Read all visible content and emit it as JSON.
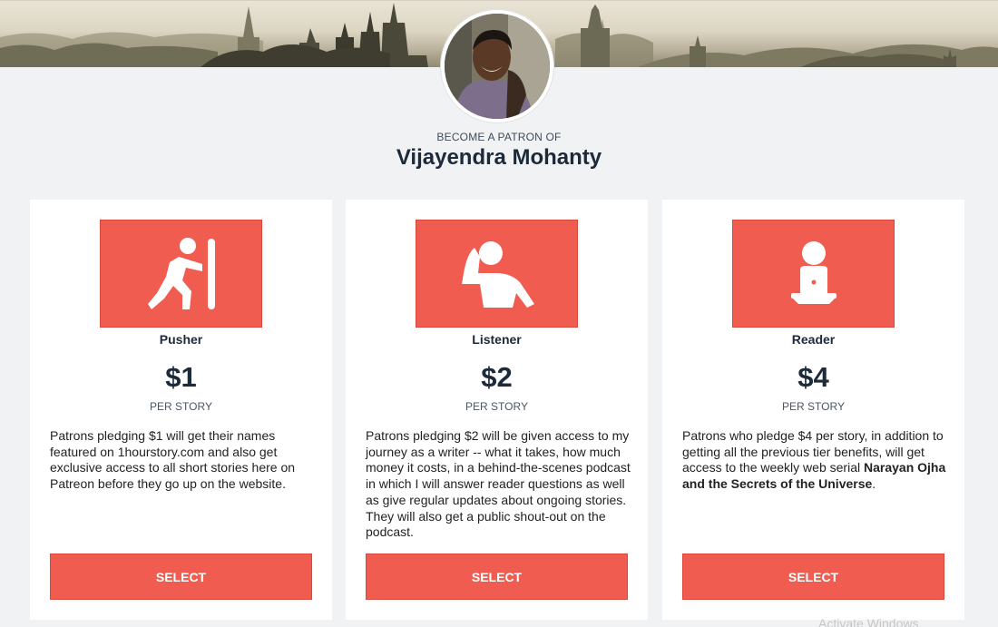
{
  "header": {
    "eyebrow": "BECOME A PATRON OF",
    "creator_name": "Vijayendra Mohanty"
  },
  "tiers": [
    {
      "name": "Pusher",
      "icon": "pushing-figure-icon",
      "price": "$1",
      "per": "PER STORY",
      "description": "Patrons pledging $1 will get their names featured on 1hourstory.com and also get exclusive access to all short stories here on Patreon before they go up on the website.",
      "button": "SELECT"
    },
    {
      "name": "Listener",
      "icon": "listening-figure-icon",
      "price": "$2",
      "per": "PER STORY",
      "description": "Patrons pledging $2 will be given access to my journey as a writer -- what it takes, how much money it costs, in a behind-the-scenes podcast in which I will answer reader questions as well as give regular updates about ongoing stories. They will also get a public shout-out on the podcast.",
      "button": "SELECT"
    },
    {
      "name": "Reader",
      "icon": "reader-laptop-icon",
      "price": "$4",
      "per": "PER STORY",
      "description_before": "Patrons who pledge $4 per story, in addition to getting all the previous tier benefits, will get access to the weekly web serial ",
      "description_bold": "Narayan Ojha and the Secrets of the Universe",
      "description_after": ".",
      "button": "SELECT"
    }
  ],
  "watermark": "Activate Windows",
  "colors": {
    "accent": "#f15c50",
    "page_background": "#f1f2f3",
    "heading": "#1c2a3a"
  }
}
